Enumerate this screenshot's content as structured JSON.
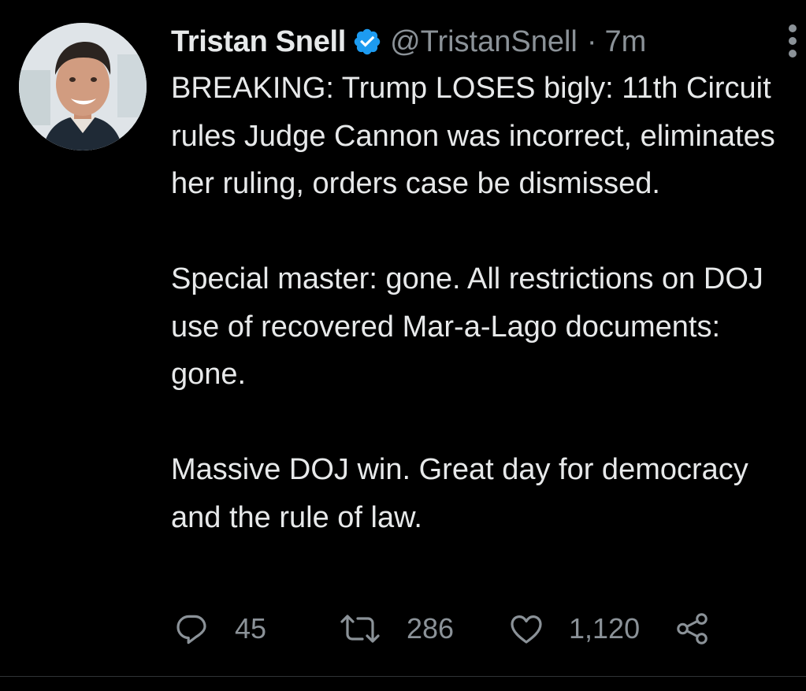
{
  "tweet": {
    "author": {
      "display_name": "Tristan Snell",
      "handle": "@TristanSnell",
      "verified": true,
      "avatar": "profile-photo"
    },
    "separator": "·",
    "time": "7m",
    "paragraphs": [
      "BREAKING: Trump LOSES bigly: 11th Circuit rules Judge Cannon was incorrect, eliminates her ruling, orders case be dismissed.",
      "Special master: gone. All restrictions on DOJ use of recovered Mar-a-Lago documents: gone.",
      "Massive DOJ win. Great day for democracy and the rule of law."
    ],
    "actions": {
      "replies": "45",
      "retweets": "286",
      "likes": "1,120"
    }
  },
  "icons": {
    "more": "more-vertical-icon",
    "verified": "verified-badge-icon",
    "reply": "reply-icon",
    "retweet": "retweet-icon",
    "like": "heart-icon",
    "share": "share-icon"
  },
  "colors": {
    "background": "#000000",
    "primary_text": "#e7e9ea",
    "secondary_text": "#8b9298",
    "verified_blue": "#1d9bf0",
    "divider": "#2f3336"
  }
}
